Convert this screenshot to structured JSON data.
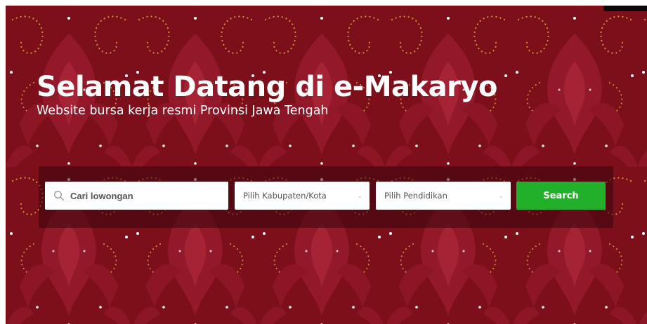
{
  "hero": {
    "title": "Selamat Datang di e-Makaryo",
    "subtitle": "Website bursa kerja resmi Provinsi Jawa Tengah"
  },
  "search": {
    "keyword_placeholder": "Cari lowongan",
    "search_icon": "search-icon",
    "kabupaten_label": "Pilih Kabupaten/Kota",
    "pendidikan_label": "Pilih Pendidikan",
    "dropdown_icon": "chevron-down-icon",
    "button_label": "Search"
  },
  "colors": {
    "hero_background": "#7d0f1a",
    "pattern_motif": "#9a1e2c",
    "pattern_dots_gold": "#c8963a",
    "search_button": "#22b02b",
    "text_white": "#ffffff"
  }
}
